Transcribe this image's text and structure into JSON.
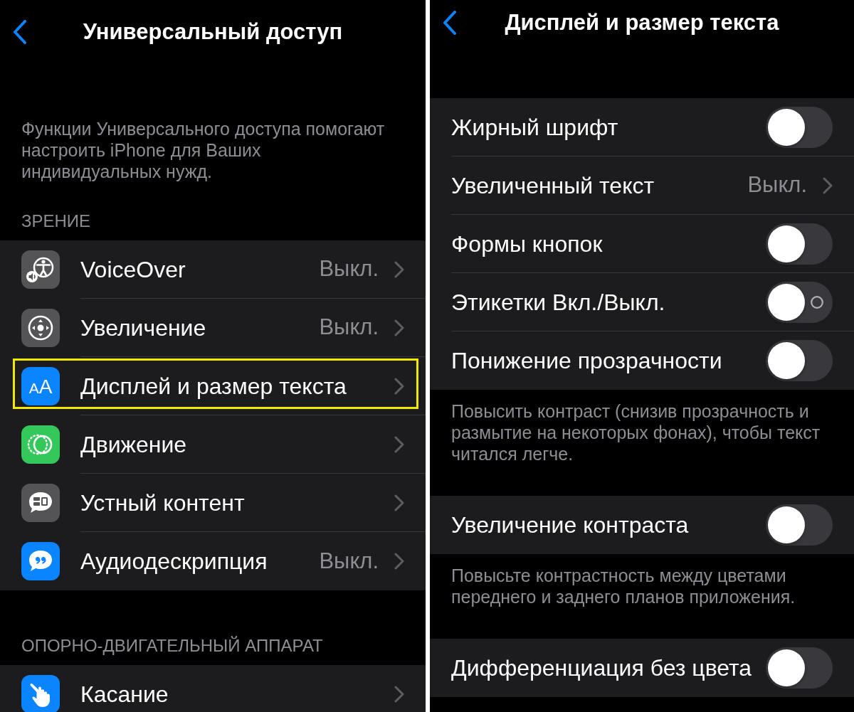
{
  "left_screen": {
    "title": "Универсальный доступ",
    "description": "Функции Универсального доступа помогают настроить iPhone для Ваших индивидуальных нужд.",
    "sections": [
      {
        "header": "ЗРЕНИЕ",
        "rows": [
          {
            "kind": "voiceover",
            "label": "VoiceOver",
            "value": "Выкл.",
            "color": "#545456",
            "highlighted": false
          },
          {
            "kind": "zoom",
            "label": "Увеличение",
            "value": "Выкл.",
            "color": "#545456",
            "highlighted": false
          },
          {
            "kind": "textsize",
            "label": "Дисплей и размер текста",
            "icon_text": "AA",
            "color": "#0a84ff",
            "highlighted": true
          },
          {
            "kind": "motion",
            "label": "Движение",
            "color": "#34c759",
            "highlighted": false
          },
          {
            "kind": "speech",
            "label": "Устный контент",
            "color": "#545456",
            "highlighted": false
          },
          {
            "kind": "audio",
            "label": "Аудиодескрипция",
            "value": "Выкл.",
            "color": "#0a84ff",
            "highlighted": false
          }
        ]
      },
      {
        "header": "ОПОРНО-ДВИГАТЕЛЬНЫЙ АППАРАТ",
        "rows": [
          {
            "kind": "touch",
            "label": "Касание",
            "color": "#0a84ff",
            "highlighted": false
          }
        ]
      }
    ]
  },
  "right_screen": {
    "title": "Дисплей и размер текста",
    "groups": [
      {
        "rows": [
          {
            "kind": "toggle",
            "label": "Жирный шрифт",
            "on": false,
            "off_glyph": false
          },
          {
            "kind": "link",
            "label": "Увеличенный текст",
            "value": "Выкл."
          },
          {
            "kind": "toggle",
            "label": "Формы кнопок",
            "on": false,
            "off_glyph": false
          },
          {
            "kind": "toggle",
            "label": "Этикетки Вкл./Выкл.",
            "on": false,
            "off_glyph": true
          },
          {
            "kind": "toggle",
            "label": "Понижение прозрачности",
            "on": false,
            "off_glyph": false
          }
        ],
        "footer": "Повысить контраст (снизив прозрачность и размытие на некоторых фонах), чтобы текст читался легче."
      },
      {
        "rows": [
          {
            "kind": "toggle",
            "label": "Увеличение контраста",
            "on": false,
            "off_glyph": false
          }
        ],
        "footer": "Повысьте контрастность между цветами переднего и заднего планов приложения."
      },
      {
        "rows": [
          {
            "kind": "toggle",
            "label": "Дифференциация без цвета",
            "on": false,
            "off_glyph": false
          }
        ]
      }
    ]
  }
}
